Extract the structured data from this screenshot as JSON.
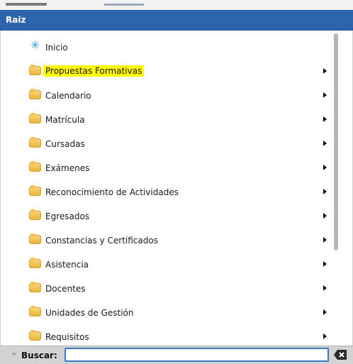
{
  "header": {
    "title": "Raiz"
  },
  "menu": {
    "items": [
      {
        "label": "Inicio",
        "icon": "snowflake-icon",
        "has_submenu": false,
        "highlighted": false
      },
      {
        "label": "Propuestas Formativas",
        "icon": "folder-icon",
        "has_submenu": true,
        "highlighted": true
      },
      {
        "label": "Calendario",
        "icon": "folder-icon",
        "has_submenu": true,
        "highlighted": false
      },
      {
        "label": "Matrícula",
        "icon": "folder-icon",
        "has_submenu": true,
        "highlighted": false
      },
      {
        "label": "Cursadas",
        "icon": "folder-icon",
        "has_submenu": true,
        "highlighted": false
      },
      {
        "label": "Exámenes",
        "icon": "folder-icon",
        "has_submenu": true,
        "highlighted": false
      },
      {
        "label": "Reconocimiento de Actividades",
        "icon": "folder-icon",
        "has_submenu": true,
        "highlighted": false
      },
      {
        "label": "Egresados",
        "icon": "folder-icon",
        "has_submenu": true,
        "highlighted": false
      },
      {
        "label": "Constancias y Certificados",
        "icon": "folder-icon",
        "has_submenu": true,
        "highlighted": false
      },
      {
        "label": "Asistencia",
        "icon": "folder-icon",
        "has_submenu": true,
        "highlighted": false
      },
      {
        "label": "Docentes",
        "icon": "folder-icon",
        "has_submenu": true,
        "highlighted": false
      },
      {
        "label": "Unidades de Gestión",
        "icon": "folder-icon",
        "has_submenu": true,
        "highlighted": false
      },
      {
        "label": "Requisitos",
        "icon": "folder-icon",
        "has_submenu": true,
        "highlighted": false
      }
    ]
  },
  "search": {
    "label": "Buscar:",
    "value": ""
  },
  "colors": {
    "header_bg": "#2e64ac",
    "highlight": "#fffb00",
    "folder": "#eeb33b",
    "search_border": "#3a78c7"
  }
}
